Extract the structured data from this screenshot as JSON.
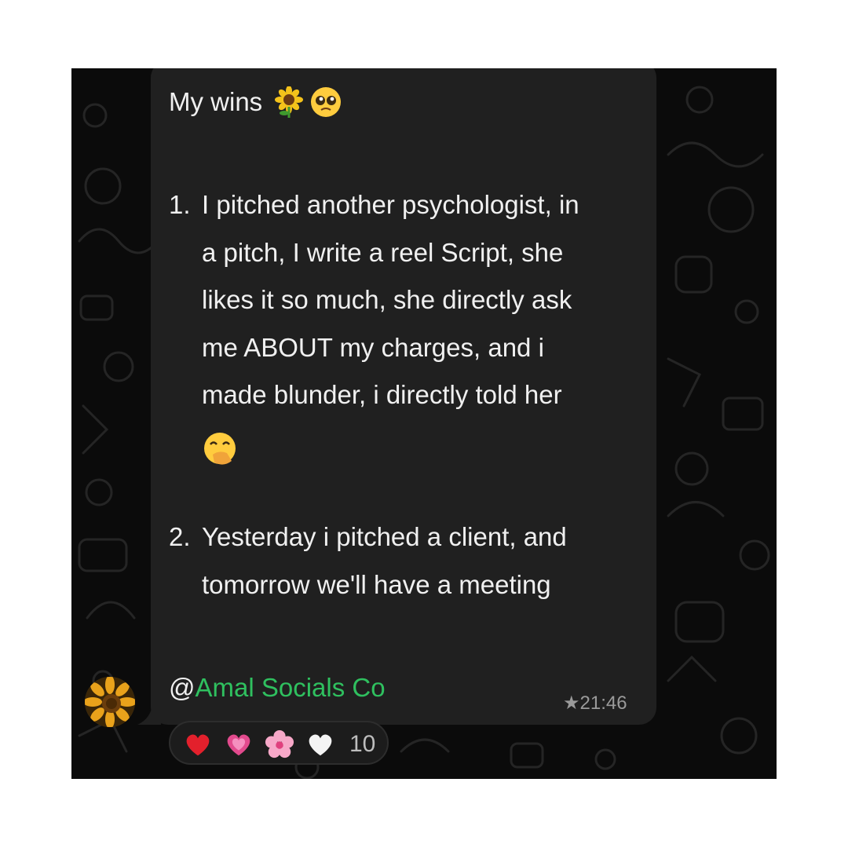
{
  "message": {
    "title": "My wins",
    "title_emojis": [
      "sunflower-icon",
      "pleading-face-icon"
    ],
    "items": [
      {
        "number": "1.",
        "lines": [
          "I pitched another psychologist, in",
          "a pitch, I write a reel Script, she",
          "likes it so much, she directly ask",
          "me ABOUT my charges, and i",
          "made blunder, i directly told her"
        ],
        "trailing_emoji": "hand-over-mouth-icon"
      },
      {
        "number": "2.",
        "lines": [
          "Yesterday i pitched a client, and",
          "tomorrow we'll have a meeting"
        ]
      }
    ],
    "signature_prefix": "@",
    "signature_name": "Amal Socials Co",
    "time": "★21:46"
  },
  "reactions": {
    "emojis": [
      "red-heart-icon",
      "growing-heart-icon",
      "cherry-blossom-icon",
      "white-heart-icon"
    ],
    "count": "10"
  },
  "colors": {
    "chat_background": "#0b0b0b",
    "bubble": "#202020",
    "text": "#f0f0f0",
    "signature_name": "#2fc05f",
    "time": "#9a9a9a"
  }
}
